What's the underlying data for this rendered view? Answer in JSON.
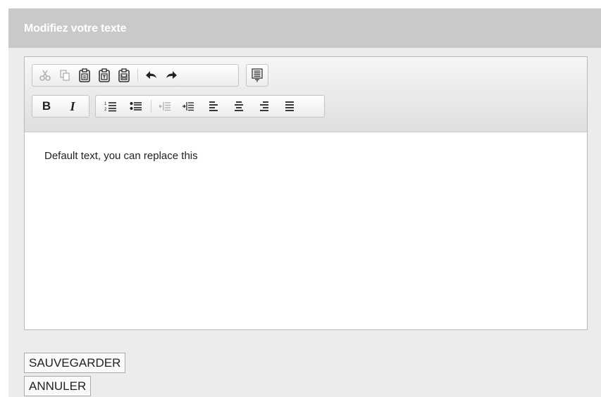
{
  "panel": {
    "title": "Modifiez votre texte"
  },
  "toolbar": {
    "row1": [
      {
        "name": "cut-icon",
        "enabled": false
      },
      {
        "name": "copy-icon",
        "enabled": false
      },
      {
        "name": "paste-icon",
        "enabled": true
      },
      {
        "name": "paste-text-icon",
        "enabled": true
      },
      {
        "name": "paste-word-icon",
        "enabled": true
      },
      {
        "name": "undo-icon",
        "enabled": true
      },
      {
        "name": "redo-icon",
        "enabled": true
      },
      {
        "name": "source-icon",
        "enabled": true
      }
    ],
    "row2": [
      {
        "name": "bold-icon",
        "label": "B"
      },
      {
        "name": "italic-icon",
        "label": "I"
      },
      {
        "name": "numbered-list-icon"
      },
      {
        "name": "bulleted-list-icon"
      },
      {
        "name": "outdent-icon",
        "enabled": false
      },
      {
        "name": "indent-icon",
        "enabled": true
      },
      {
        "name": "align-left-icon"
      },
      {
        "name": "align-center-icon"
      },
      {
        "name": "align-right-icon"
      },
      {
        "name": "justify-icon"
      }
    ],
    "bold_label": "B",
    "italic_label": "I"
  },
  "editor": {
    "content": "Default text, you can replace this"
  },
  "buttons": {
    "save_label": "SAUVEGARDER",
    "cancel_label": "ANNULER"
  },
  "colors": {
    "header_bg": "#c9c9c9",
    "panel_bg": "#ececec",
    "title_text": "#ffffff"
  }
}
